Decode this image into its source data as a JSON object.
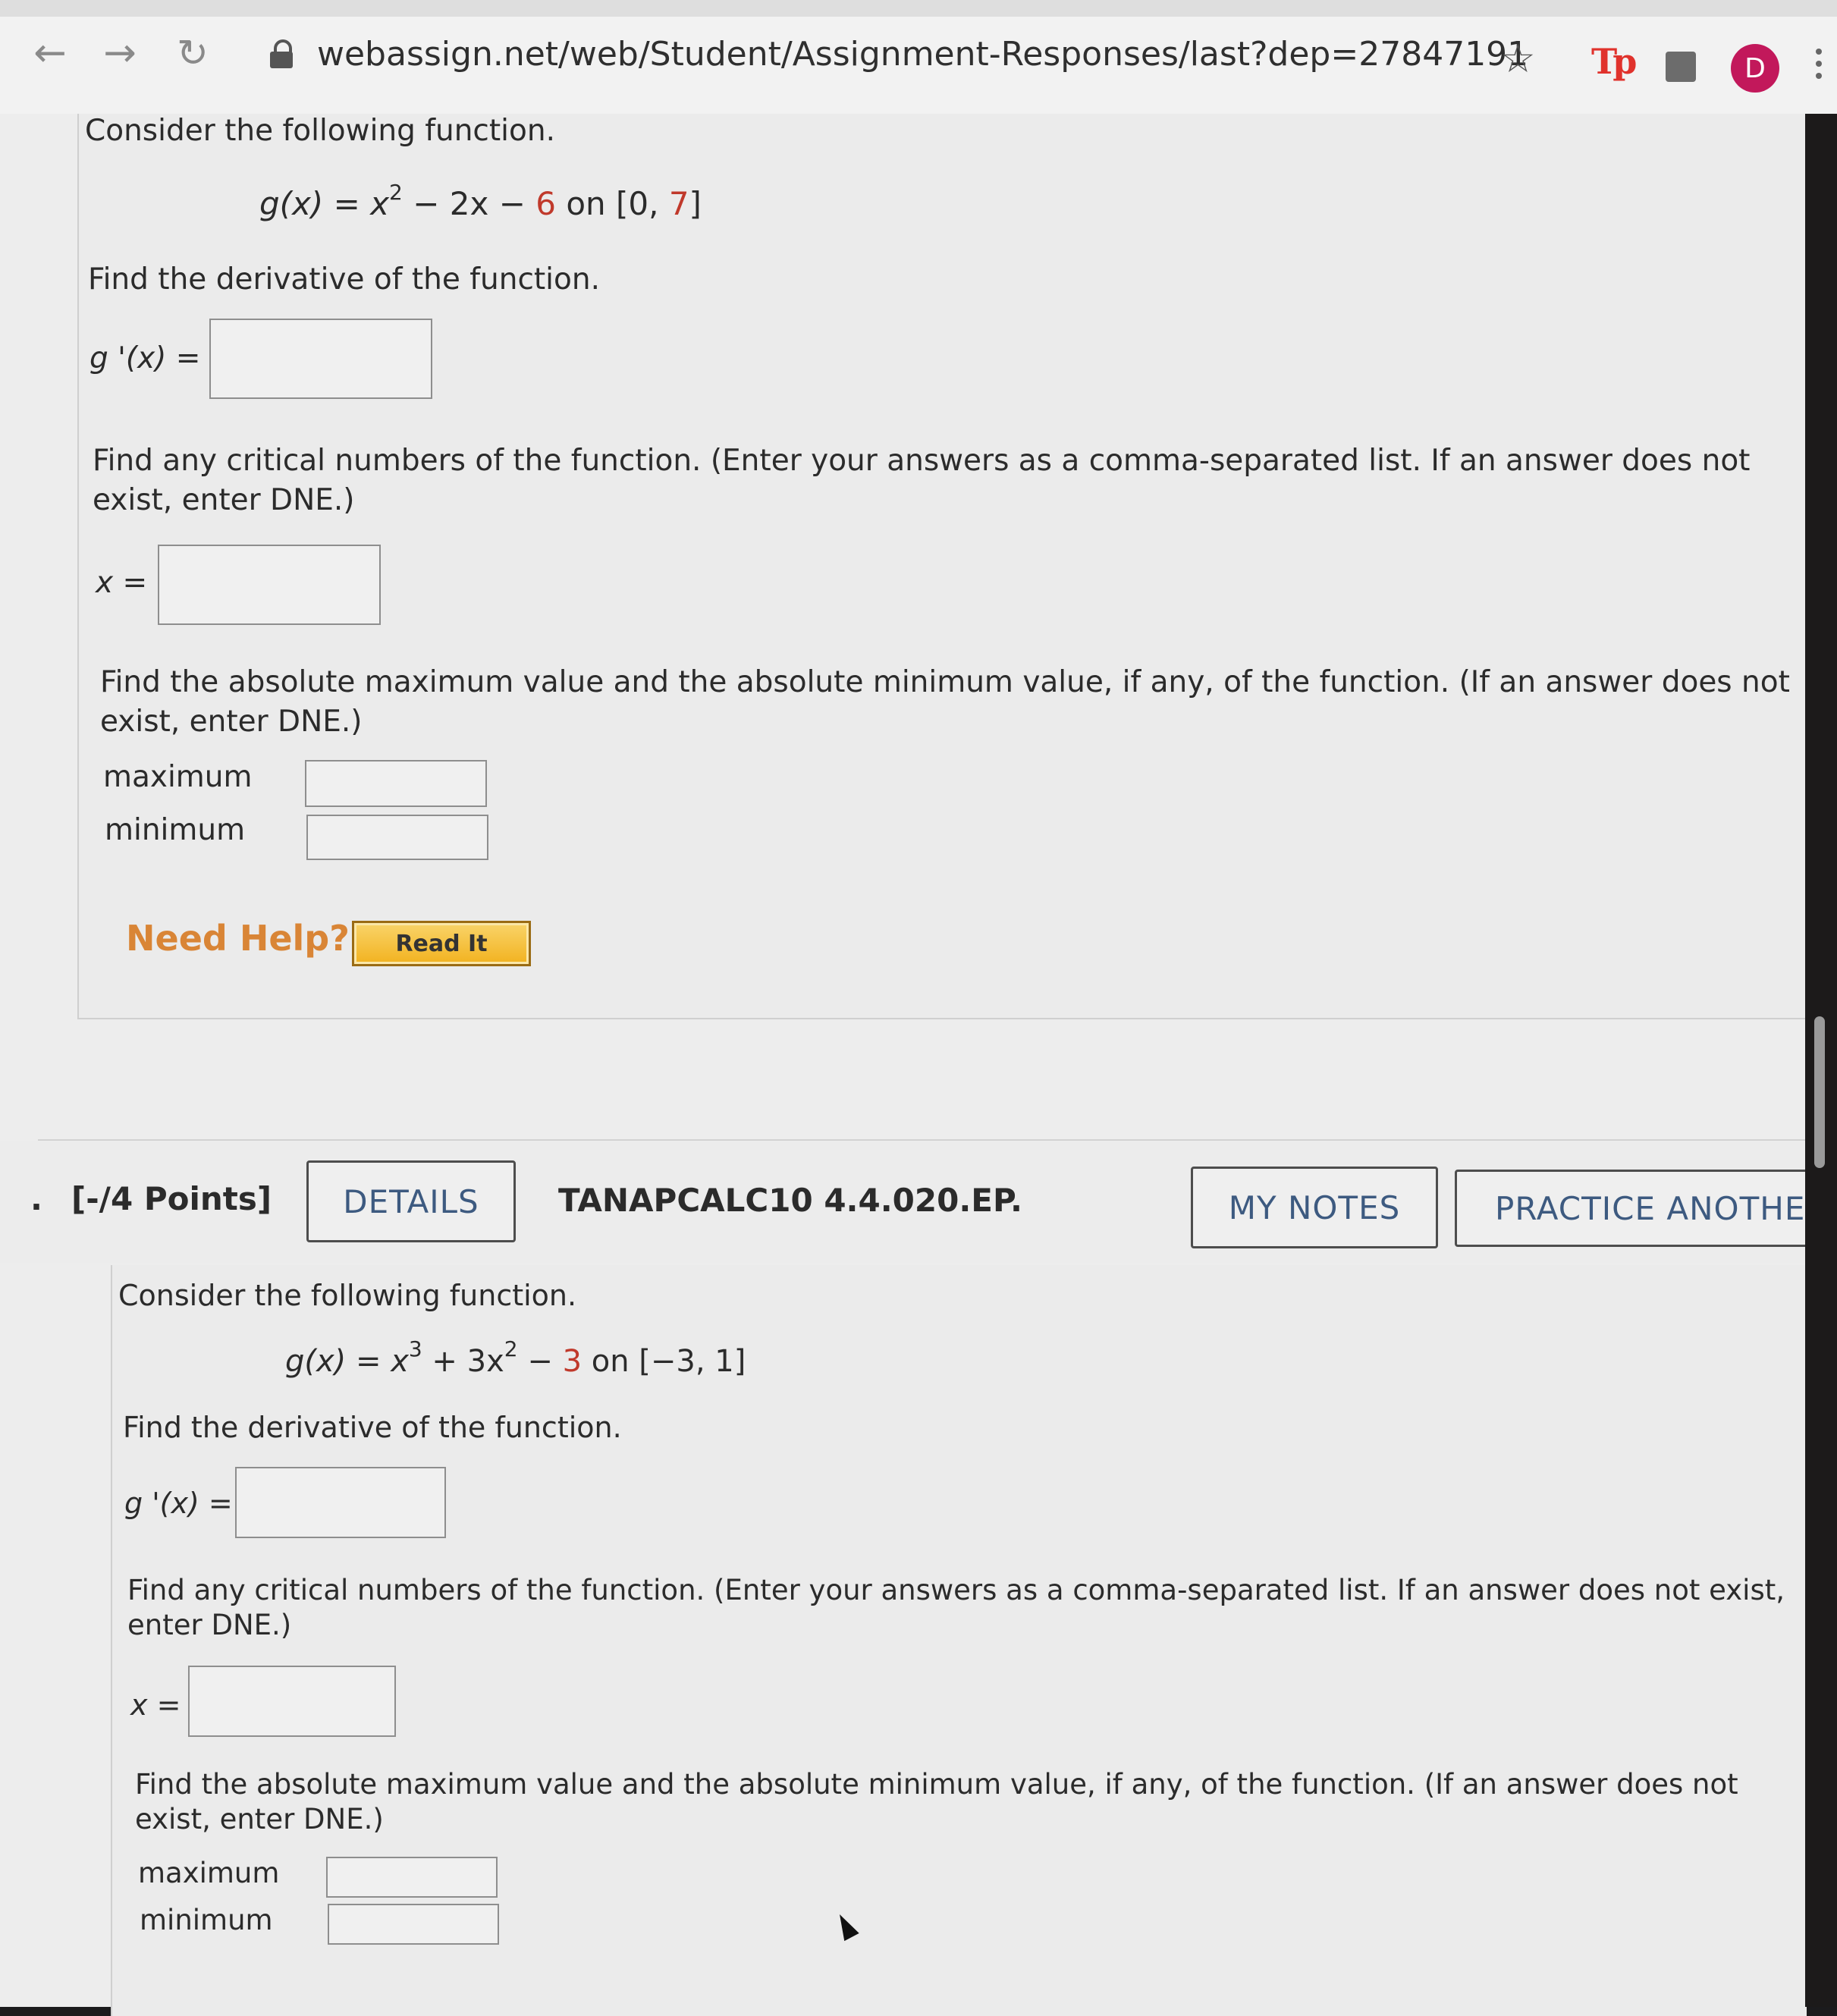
{
  "browser": {
    "url": "webassign.net/web/Student/Assignment-Responses/last?dep=27847191",
    "back_icon": "arrow-left-icon",
    "forward_icon": "arrow-right-icon",
    "reload_icon": "reload-icon",
    "avatar_initial": "D",
    "avatar_color": "#c2185b"
  },
  "q1": {
    "intro": "Consider the following function.",
    "func_lhs": "g(x) = x",
    "func_exp": "2",
    "func_mid": " − 2x − ",
    "func_const": "6",
    "func_on": " on [0, ",
    "func_end": "7",
    "func_close": "]",
    "derivative_prompt": "Find the derivative of the function.",
    "derivative_label": "g '(x) =",
    "critical_prompt": "Find any critical numbers of the function. (Enter your answers as a comma-separated list. If an answer does not exist, enter DNE.)",
    "critical_label": "x =",
    "extrema_prompt": "Find the absolute maximum value and the absolute minimum value, if any, of the function. (If an answer does not exist, enter DNE.)",
    "maximum_label": "maximum",
    "minimum_label": "minimum",
    "need_help": "Need Help?",
    "read_it": "Read It"
  },
  "q2_header": {
    "number_prefix": ".",
    "points": "[-/4 Points]",
    "details": "DETAILS",
    "code": "TANAPCALC10 4.4.020.EP.",
    "my_notes": "MY NOTES",
    "practice_another": "PRACTICE ANOTHER"
  },
  "q2": {
    "intro": "Consider the following function.",
    "func_lhs": "g(x) = x",
    "func_exp1": "3",
    "func_mid": " + 3x",
    "func_exp2": "2",
    "func_minus": " − ",
    "func_const": "3",
    "func_tail": " on [−3, 1]",
    "derivative_prompt": "Find the derivative of the function.",
    "derivative_label": "g '(x) =",
    "critical_prompt": "Find any critical numbers of the function. (Enter your answers as a comma-separated list. If an answer does not exist, enter DNE.)",
    "critical_label": "x =",
    "extrema_prompt": "Find the absolute maximum value and the absolute minimum value, if any, of the function. (If an answer does not exist, enter DNE.)",
    "maximum_label": "maximum",
    "minimum_label": "minimum"
  },
  "colors": {
    "accent_red": "#c0392b",
    "help_orange": "#d98536",
    "button_text_blue": "#3d5a80"
  }
}
